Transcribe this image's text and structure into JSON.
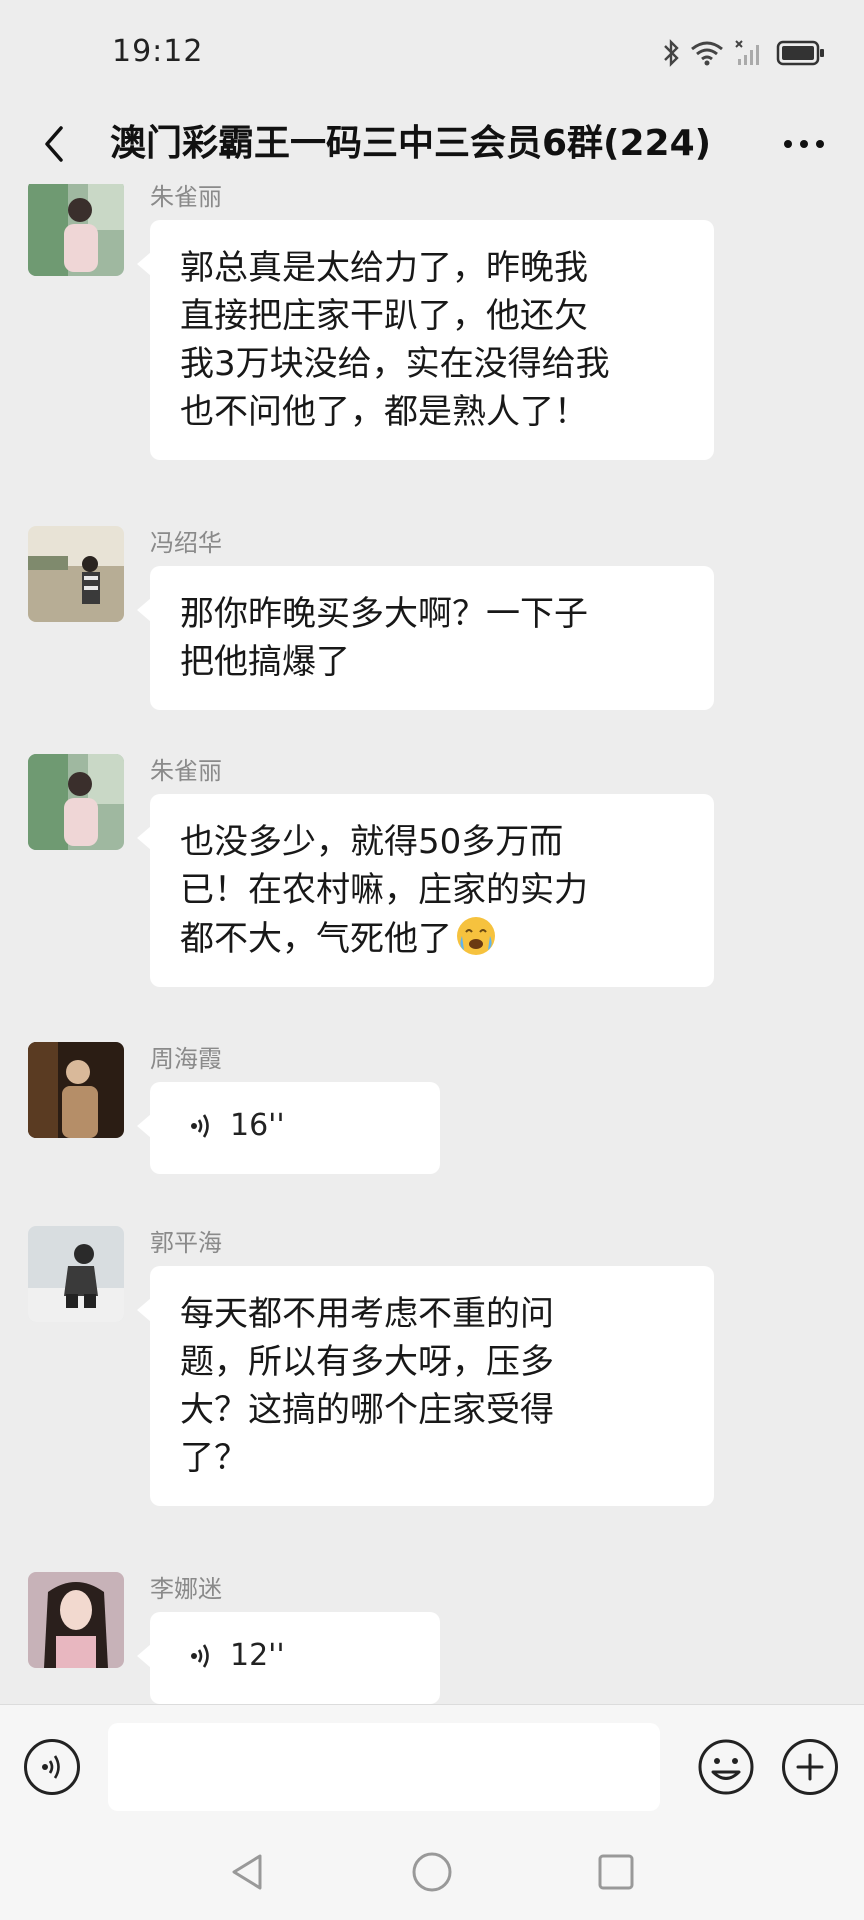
{
  "status_bar": {
    "time": "19:12"
  },
  "header": {
    "back_icon": "chevron-left-icon",
    "title": "澳门彩霸王一码三中三会员6群(224)",
    "more_icon": "more-dots-icon"
  },
  "messages": [
    {
      "sender": "朱雀丽",
      "type": "text",
      "lines": [
        "郭总真是太给力了，昨晚我",
        "直接把庄家干趴了，他还欠",
        "我3万块没给，实在没得给我",
        "也不问他了，都是熟人了！"
      ]
    },
    {
      "sender": "冯绍华",
      "type": "text",
      "lines": [
        "那你昨晚买多大啊？一下子",
        "把他搞爆了"
      ]
    },
    {
      "sender": "朱雀丽",
      "type": "text",
      "lines": [
        "也没多少，就得50多万而",
        "已！在农村嘛，庄家的实力",
        "都不大，气死他了"
      ],
      "emoji": "crying-face-emoji"
    },
    {
      "sender": "周海霞",
      "type": "voice",
      "duration": "16''"
    },
    {
      "sender": "郭平海",
      "type": "text",
      "lines": [
        "每天都不用考虑不重的问",
        "题，所以有多大呀，压多",
        "大？这搞的哪个庄家受得",
        "了？"
      ]
    },
    {
      "sender": "李娜迷",
      "type": "voice",
      "duration": "12''"
    }
  ],
  "input_bar": {
    "voice_icon": "voice-input-icon",
    "input_value": "",
    "emoji_icon": "emoji-icon",
    "plus_icon": "plus-icon"
  },
  "nav_bar": {
    "back_icon": "nav-back-icon",
    "home_icon": "nav-home-icon",
    "recents_icon": "nav-recents-icon"
  },
  "colors": {
    "background": "#ededed",
    "bubble": "#ffffff",
    "sender_name": "#8a8a8a"
  }
}
